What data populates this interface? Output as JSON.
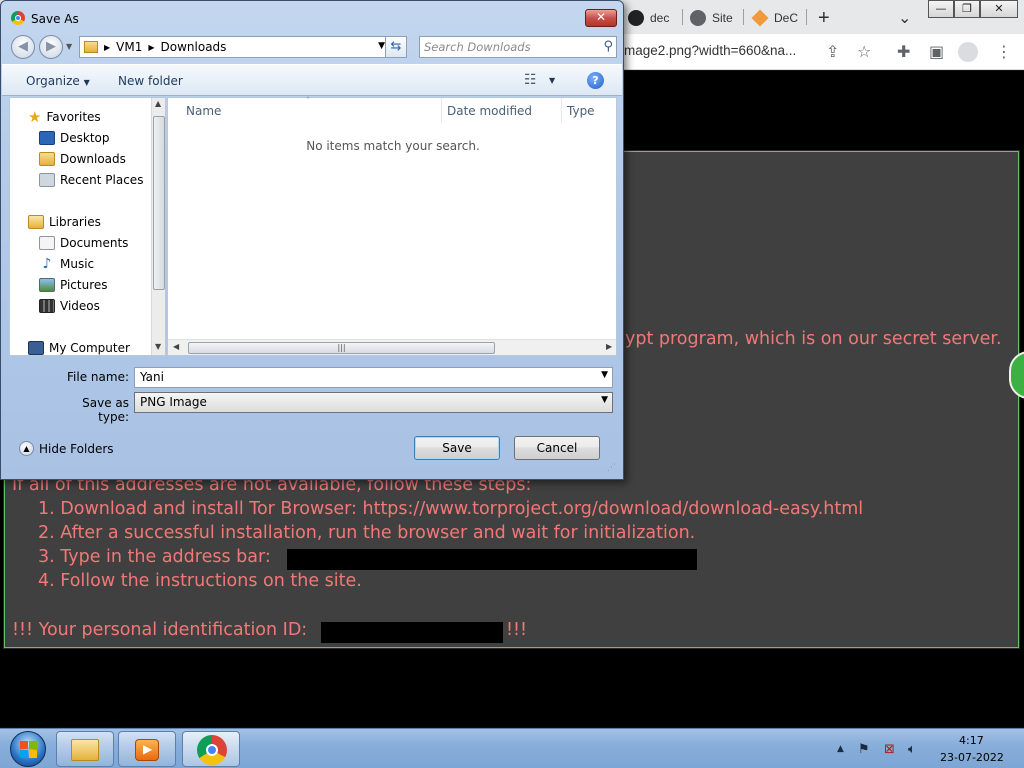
{
  "browser": {
    "tabs": [
      {
        "label": "dec",
        "icon": "github-icon"
      },
      {
        "label": "Site",
        "icon": "globe-icon"
      },
      {
        "label": "DeC",
        "icon": "diamond-icon"
      }
    ],
    "new_tab_icon": "+",
    "menu_icon": "⌄",
    "url_fragment": "mage2.png?width=660&na...",
    "window_controls": {
      "minimize": "—",
      "restore": "❐",
      "close": "✕"
    }
  },
  "page": {
    "line_partial": "ypt program, which is on our secret server.",
    "intro": "If all of this addresses are not available, follow these steps:",
    "steps": [
      "1. Download and install Tor Browser: https://www.torproject.org/download/download-easy.html",
      "2. After a successful installation, run the browser and wait for initialization.",
      "3. Type in the address bar:",
      "4. Follow the instructions on the site."
    ],
    "id_prefix": "!!! Your personal identification ID:",
    "id_suffix": "!!!",
    "text_color": "#f27878",
    "border_color": "#62c462"
  },
  "dialog": {
    "title": "Save As",
    "close_glyph": "✕",
    "breadcrumb": [
      "VM1",
      "Downloads"
    ],
    "search_placeholder": "Search Downloads",
    "organize_label": "Organize",
    "new_folder_label": "New folder",
    "nav": {
      "favorites_header": "Favorites",
      "favorites": [
        "Desktop",
        "Downloads",
        "Recent Places"
      ],
      "libraries_header": "Libraries",
      "libraries": [
        "Documents",
        "Music",
        "Pictures",
        "Videos"
      ],
      "computer_header": "My Computer"
    },
    "columns": [
      "Name",
      "Date modified",
      "Type"
    ],
    "empty_message": "No items match your search.",
    "file_name_label": "File name:",
    "file_name_value": "Yani",
    "save_type_label": "Save as type:",
    "save_type_value": "PNG Image",
    "save_button": "Save",
    "cancel_button": "Cancel",
    "hide_folders_label": "Hide Folders"
  },
  "taskbar": {
    "apps": [
      "file-explorer-icon",
      "media-player-icon",
      "chrome-icon"
    ],
    "time": "4:17",
    "date": "23-07-2022"
  }
}
